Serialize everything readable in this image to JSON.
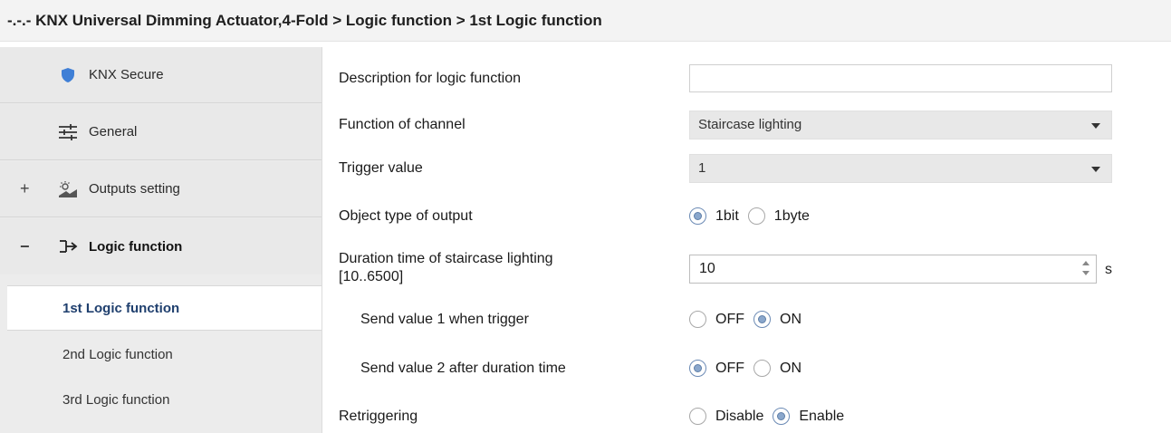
{
  "title": "-.-.- KNX Universal Dimming Actuator,4-Fold > Logic function > 1st Logic function",
  "sidebar": {
    "items": [
      {
        "label": "KNX Secure",
        "icon": "shield-icon",
        "expander": ""
      },
      {
        "label": "General",
        "icon": "sliders-icon",
        "expander": ""
      },
      {
        "label": "Outputs setting",
        "icon": "outputs-icon",
        "expander": "+"
      },
      {
        "label": "Logic function",
        "icon": "logic-arrow-icon",
        "expander": "−"
      }
    ],
    "sub_items": [
      {
        "label": "1st Logic function",
        "active": true
      },
      {
        "label": "2nd Logic function",
        "active": false
      },
      {
        "label": "3rd Logic function",
        "active": false
      }
    ]
  },
  "form": {
    "description": {
      "label": "Description for logic function",
      "value": ""
    },
    "function_of_channel": {
      "label": "Function of channel",
      "value": "Staircase lighting"
    },
    "trigger_value": {
      "label": "Trigger value",
      "value": "1"
    },
    "object_type": {
      "label": "Object type of  output",
      "options": [
        "1bit",
        "1byte"
      ],
      "selected": "1bit"
    },
    "duration": {
      "label_line1": "Duration time of staircase lighting",
      "label_line2": "[10..6500]",
      "value": "10",
      "unit": "s"
    },
    "send_value_1": {
      "label": "Send value 1 when trigger",
      "options": [
        "OFF",
        "ON"
      ],
      "selected": "ON"
    },
    "send_value_2": {
      "label": "Send value 2 after duration time",
      "options": [
        "OFF",
        "ON"
      ],
      "selected": "OFF"
    },
    "retriggering": {
      "label": "Retriggering",
      "options": [
        "Disable",
        "Enable"
      ],
      "selected": "Enable"
    }
  },
  "colors": {
    "accent": "#5f7fa8",
    "shield": "#3f7fd6",
    "active_sub_text": "#1f3f6e"
  }
}
